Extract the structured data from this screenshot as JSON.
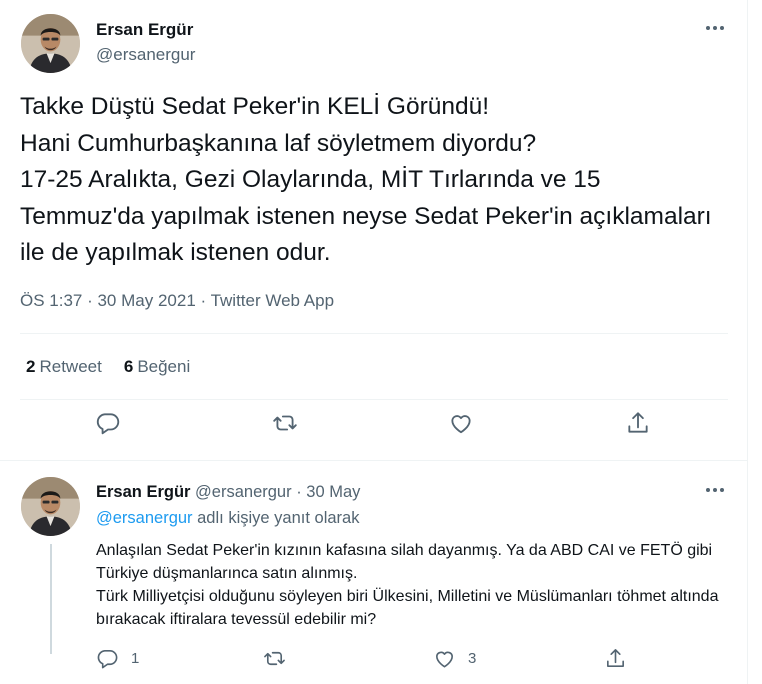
{
  "main_tweet": {
    "author_name": "Ersan Ergür",
    "author_handle": "@ersanergur",
    "text": "Takke Düştü Sedat Peker'in KELİ Göründü!\nHani Cumhurbaşkanına laf söyletmem diyordu?\n17-25 Aralıkta, Gezi Olaylarında, MİT Tırlarında ve 15 Temmuz'da yapılmak istenen neyse Sedat Peker'in açıklamaları ile de yapılmak istenen odur.",
    "meta": "ÖS 1:37 · 30 May 2021 · Twitter Web App",
    "retweet_count": "2",
    "retweet_label": "Retweet",
    "like_count": "6",
    "like_label": "Beğeni"
  },
  "reply_tweet": {
    "author_name": "Ersan Ergür",
    "author_handle": "@ersanergur",
    "separator": "·",
    "date": "30 May",
    "reply_to_handle": "@ersanergur",
    "reply_to_suffix": " adlı kişiye yanıt olarak",
    "text": "Anlaşılan Sedat Peker'in kızının kafasına silah dayanmış. Ya da ABD CAI ve FETÖ gibi Türkiye düşmanlarınca satın alınmış.\nTürk Milliyetçisi olduğunu söyleyen biri Ülkesini, Milletini ve Müslümanları töhmet altında bırakacak iftiralara tevessül edebilir mi?",
    "reply_count": "1",
    "retweet_count": "",
    "like_count": "3"
  },
  "icons": {
    "reply": "reply-icon",
    "retweet": "retweet-icon",
    "like": "heart-icon",
    "share": "share-icon",
    "more": "more-icon"
  },
  "colors": {
    "text_primary": "#0f1419",
    "text_secondary": "#536471",
    "link": "#1d9bf0",
    "divider": "#eff3f4"
  }
}
